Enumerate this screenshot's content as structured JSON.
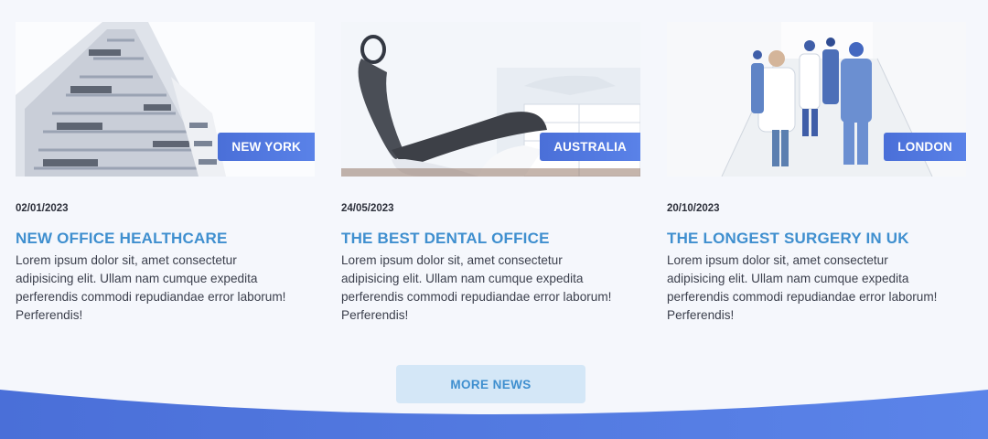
{
  "news": [
    {
      "image_desc": "modern-building-photo",
      "location": "NEW YORK",
      "date": "02/01/2023",
      "title": "NEW OFFICE HEALTHCARE",
      "excerpt": "Lorem ipsum dolor sit, amet consectetur adipisicing elit. Ullam nam cumque expedita perferendis commodi repudiandae error laborum! Perferendis!"
    },
    {
      "image_desc": "dental-chair-photo",
      "location": "AUSTRALIA",
      "date": "24/05/2023",
      "title": "THE BEST DENTAL OFFICE",
      "excerpt": "Lorem ipsum dolor sit, amet consectetur adipisicing elit. Ullam nam cumque expedita perferendis commodi repudiandae error laborum! Perferendis!"
    },
    {
      "image_desc": "surgical-team-hallway-photo",
      "location": "LONDON",
      "date": "20/10/2023",
      "title": "THE LONGEST SURGERY IN UK",
      "excerpt": "Lorem ipsum dolor sit, amet consectetur adipisicing elit. Ullam nam cumque expedita perferendis commodi repudiandae error laborum! Perferendis!"
    }
  ],
  "more_button": {
    "label": "MORE NEWS"
  },
  "colors": {
    "accent_blue": "#3f8fcf",
    "tag_gradient": [
      "#4a6fd8",
      "#5a82e8"
    ],
    "button_bg": "#d4e7f7",
    "page_bg": "#f5f7fc",
    "wave": "#4a72dc"
  }
}
